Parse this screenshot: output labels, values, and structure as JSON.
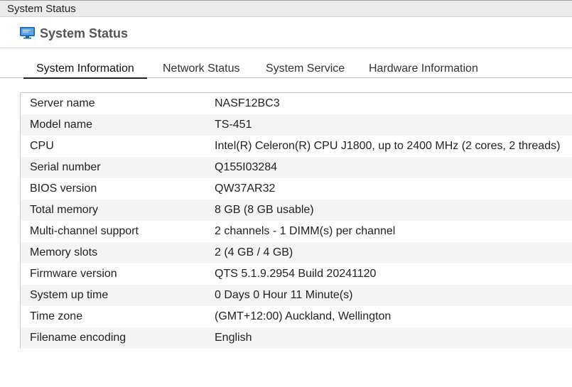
{
  "window": {
    "title": "System Status"
  },
  "header": {
    "title": "System Status",
    "icon": "monitor-icon"
  },
  "tabs": [
    {
      "label": "System Information",
      "active": true
    },
    {
      "label": "Network Status",
      "active": false
    },
    {
      "label": "System Service",
      "active": false
    },
    {
      "label": "Hardware Information",
      "active": false
    }
  ],
  "info": {
    "rows": [
      {
        "label": "Server name",
        "value": "NASF12BC3"
      },
      {
        "label": "Model name",
        "value": "TS-451"
      },
      {
        "label": "CPU",
        "value": "Intel(R) Celeron(R) CPU J1800, up to 2400 MHz (2 cores, 2 threads)"
      },
      {
        "label": "Serial number",
        "value": "Q155I03284"
      },
      {
        "label": "BIOS version",
        "value": "QW37AR32"
      },
      {
        "label": "Total memory",
        "value": "8 GB (8 GB usable)"
      },
      {
        "label": "Multi-channel support",
        "value": "2 channels - 1 DIMM(s) per channel"
      },
      {
        "label": "Memory slots",
        "value": "2 (4 GB / 4 GB)"
      },
      {
        "label": "Firmware version",
        "value": "QTS 5.1.9.2954 Build 20241120"
      },
      {
        "label": "System up time",
        "value": "0 Days 0 Hour 11 Minute(s)"
      },
      {
        "label": "Time zone",
        "value": "(GMT+12:00) Auckland, Wellington"
      },
      {
        "label": "Filename encoding",
        "value": "English"
      }
    ]
  },
  "colors": {
    "accent_icon": "#2f7fd0",
    "tab_underline": "#222222",
    "row_alt": "#f4f4f4"
  }
}
